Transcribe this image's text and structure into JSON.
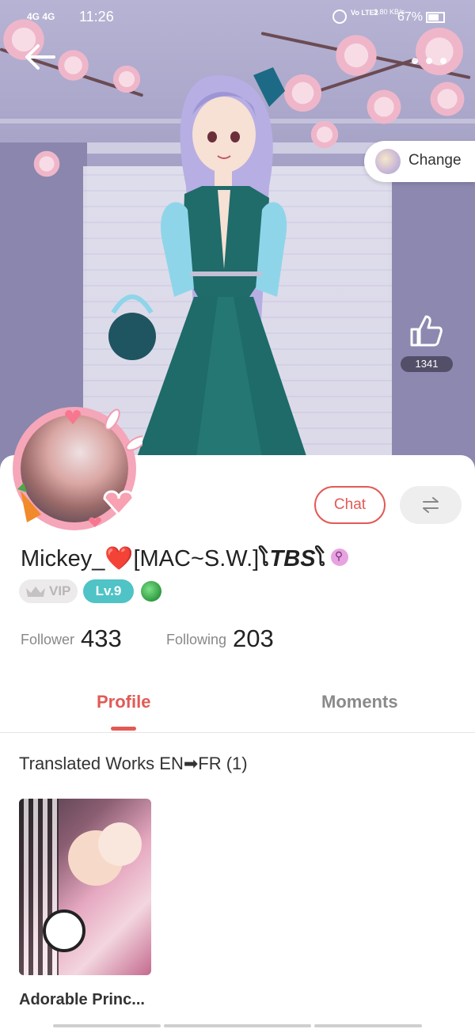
{
  "status_bar": {
    "signal_1": "4G",
    "signal_2": "4G",
    "time": "11:26",
    "volte": "Vo LTE2",
    "net_speed": "3.80 KB/s",
    "battery": "67%"
  },
  "hero": {
    "change_label": "Change",
    "like_count": "1341"
  },
  "profile": {
    "username_prefix": "Mickey_",
    "username_heart": "❤️",
    "username_mid": "[MAC~S.W.]",
    "username_bold": "TBS",
    "username_deco_1": "ໂ",
    "username_deco_2": "ໂ",
    "vip_label": "VIP",
    "level_label": "Lv.9",
    "follower_label": "Follower",
    "follower_count": "433",
    "following_label": "Following",
    "following_count": "203",
    "chat_label": "Chat"
  },
  "tabs": [
    {
      "label": "Profile",
      "active": true
    },
    {
      "label": "Moments",
      "active": false
    }
  ],
  "works": {
    "section_title": "Translated Works EN➡FR (1)",
    "items": [
      {
        "title": "Adorable Princ..."
      }
    ]
  },
  "colors": {
    "accent": "#e25a55",
    "level_badge": "#4fc3c6",
    "vip_badge": "#eceaea"
  },
  "icons": {
    "back": "arrow-left-icon",
    "like": "thumbs-up-icon",
    "swap": "swap-arrows-icon",
    "gender": "female-icon",
    "crown": "crown-icon",
    "globe": "globe-icon"
  }
}
